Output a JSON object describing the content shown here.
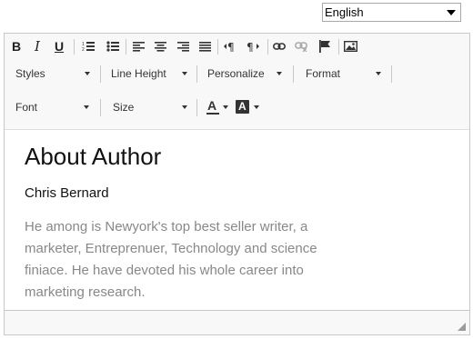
{
  "language_select": {
    "value": "English"
  },
  "toolbar": {
    "row1": {
      "buttons": [
        "bold",
        "italic",
        "underline",
        "ordered-list",
        "unordered-list",
        "align-left",
        "align-center",
        "align-right",
        "align-justify",
        "ltr",
        "rtl",
        "link",
        "unlink",
        "anchor",
        "image"
      ]
    },
    "dropdowns": {
      "styles": "Styles",
      "line_height": "Line Height",
      "personalize": "Personalize",
      "format": "Format",
      "font": "Font",
      "size": "Size"
    },
    "bold_label": "B",
    "italic_label": "I",
    "underline_label": "U",
    "font_color_label": "A",
    "bg_color_label": "A"
  },
  "content": {
    "heading": "About Author",
    "author": "Chris Bernard",
    "bio": "He among is Newyork's top best seller writer, a marketer, Entreprenuer, Technology and science finiace. He have devoted his whole career into marketing research."
  }
}
